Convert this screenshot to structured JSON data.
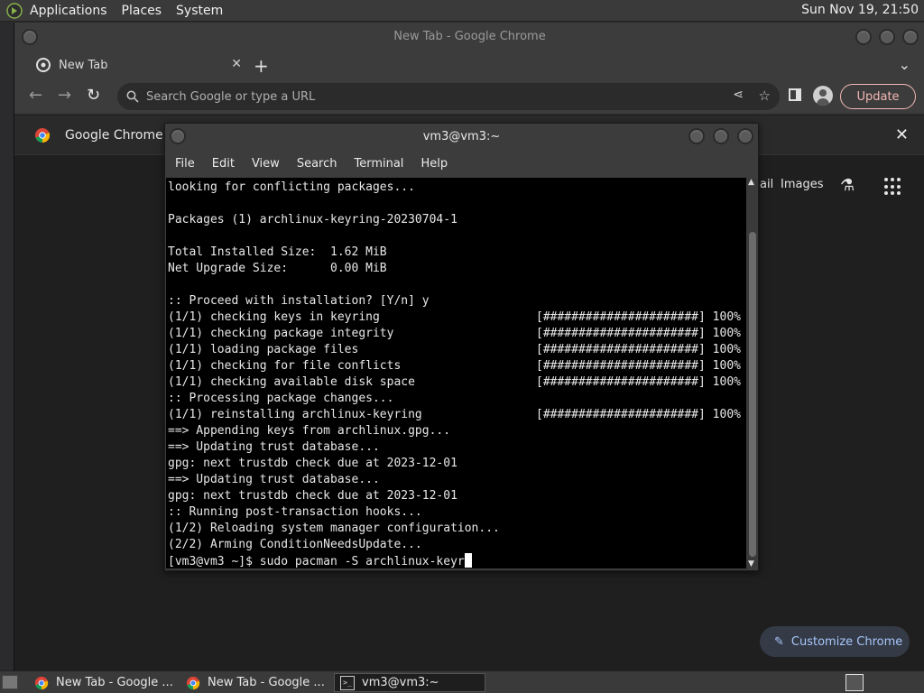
{
  "top_panel": {
    "menus": [
      "Applications",
      "Places",
      "System"
    ],
    "clock": "Sun Nov 19, 21:50"
  },
  "chrome": {
    "window_title": "New Tab - Google Chrome",
    "tab_title": "New Tab",
    "omnibox_placeholder": "Search Google or type a URL",
    "update_label": "Update",
    "infobar_text": "Google Chrome is",
    "ntp": {
      "gmail_partial": "ail",
      "images_label": "Images",
      "customize_label": "Customize Chrome"
    }
  },
  "terminal": {
    "title": "vm3@vm3:~",
    "menus": [
      "File",
      "Edit",
      "View",
      "Search",
      "Terminal",
      "Help"
    ],
    "lines": [
      "looking for conflicting packages...",
      "",
      "Packages (1) archlinux-keyring-20230704-1",
      "",
      "Total Installed Size:  1.62 MiB",
      "Net Upgrade Size:      0.00 MiB",
      "",
      ":: Proceed with installation? [Y/n] y",
      "(1/1) checking keys in keyring",
      "(1/1) checking package integrity",
      "(1/1) loading package files",
      "(1/1) checking for file conflicts",
      "(1/1) checking available disk space",
      ":: Processing package changes...",
      "(1/1) reinstalling archlinux-keyring",
      "==> Appending keys from archlinux.gpg...",
      "==> Updating trust database...",
      "gpg: next trustdb check due at 2023-12-01",
      "==> Updating trust database...",
      "gpg: next trustdb check due at 2023-12-01",
      ":: Running post-transaction hooks...",
      "(1/2) Reloading system manager configuration...",
      "(2/2) Arming ConditionNeedsUpdate...",
      "[vm3@vm3 ~]$ sudo pacman -S archlinux-keyr"
    ],
    "progress": [
      {
        "line": 8,
        "text": "[######################] 100%"
      },
      {
        "line": 9,
        "text": "[######################] 100%"
      },
      {
        "line": 10,
        "text": "[######################] 100%"
      },
      {
        "line": 11,
        "text": "[######################] 100%"
      },
      {
        "line": 12,
        "text": "[######################] 100%"
      },
      {
        "line": 14,
        "text": "[######################] 100%"
      }
    ]
  },
  "taskbar": {
    "tasks": [
      "New Tab - Google ...",
      "New Tab - Google ...",
      "vm3@vm3:~"
    ]
  }
}
